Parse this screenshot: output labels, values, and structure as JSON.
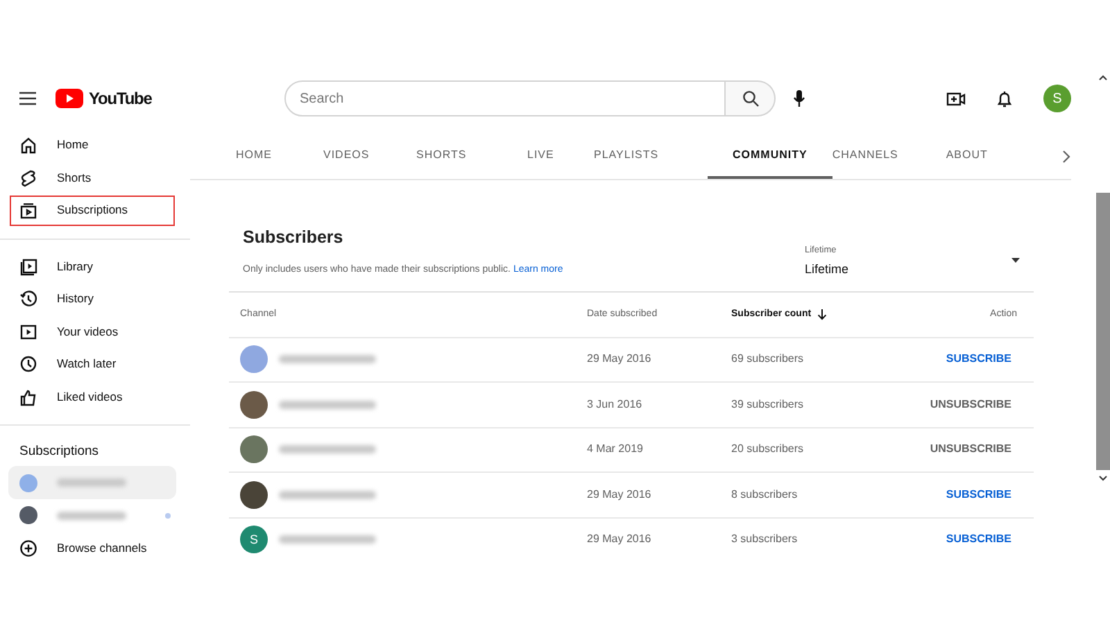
{
  "header": {
    "logo_text": "YouTube",
    "search": {
      "placeholder": "Search"
    },
    "avatar_letter": "S"
  },
  "sidebar": {
    "sections": [
      {
        "items": [
          {
            "label": "Home",
            "highlighted": false
          },
          {
            "label": "Shorts",
            "highlighted": false
          },
          {
            "label": "Subscriptions",
            "highlighted": true
          }
        ]
      },
      {
        "items": [
          {
            "label": "Library",
            "highlighted": false
          },
          {
            "label": "History",
            "highlighted": false
          },
          {
            "label": "Your videos",
            "highlighted": false
          },
          {
            "label": "Watch later",
            "highlighted": false
          },
          {
            "label": "Liked videos",
            "highlighted": false
          }
        ]
      }
    ],
    "subscriptions_title": "Subscriptions",
    "subscriptions": [
      {
        "selected": true,
        "color": "#8fb0e8",
        "new_content": false
      },
      {
        "selected": false,
        "color": "#555b66",
        "new_content": true
      }
    ],
    "browse_label": "Browse channels"
  },
  "tabs": [
    {
      "label": "HOME",
      "selected": false
    },
    {
      "label": "VIDEOS",
      "selected": false
    },
    {
      "label": "SHORTS",
      "selected": false
    },
    {
      "label": "LIVE",
      "selected": false
    },
    {
      "label": "PLAYLISTS",
      "selected": false
    },
    {
      "label": "COMMUNITY",
      "selected": true
    },
    {
      "label": "CHANNELS",
      "selected": false
    },
    {
      "label": "ABOUT",
      "selected": false
    }
  ],
  "panel": {
    "title": "Subscribers",
    "note": "Only includes users who have made their subscriptions public.",
    "link": "Learn more",
    "filter": {
      "label": "Lifetime",
      "value": "Lifetime"
    }
  },
  "table": {
    "columns": [
      {
        "label": "Channel",
        "sorted": false
      },
      {
        "label": "Date subscribed",
        "sorted": false
      },
      {
        "label": "Subscriber count",
        "sorted": true
      },
      {
        "label": "Action",
        "sorted": false
      }
    ],
    "rows": [
      {
        "color": "#8fa8e0",
        "date": "29 May 2016",
        "count": "69 subscribers",
        "action": "SUBSCRIBE",
        "subscribed": false
      },
      {
        "color": "#6b5a48",
        "date": "3 Jun 2016",
        "count": "39 subscribers",
        "action": "UNSUBSCRIBE",
        "subscribed": true
      },
      {
        "color": "#6a7560",
        "date": "4 Mar 2019",
        "count": "20 subscribers",
        "action": "UNSUBSCRIBE",
        "subscribed": true
      },
      {
        "color": "#4a4438",
        "date": "29 May 2016",
        "count": "8 subscribers",
        "action": "SUBSCRIBE",
        "subscribed": false
      },
      {
        "color": "#1f8a70",
        "letter": "S",
        "date": "29 May 2016",
        "count": "3 subscribers",
        "action": "SUBSCRIBE",
        "subscribed": false
      }
    ]
  }
}
